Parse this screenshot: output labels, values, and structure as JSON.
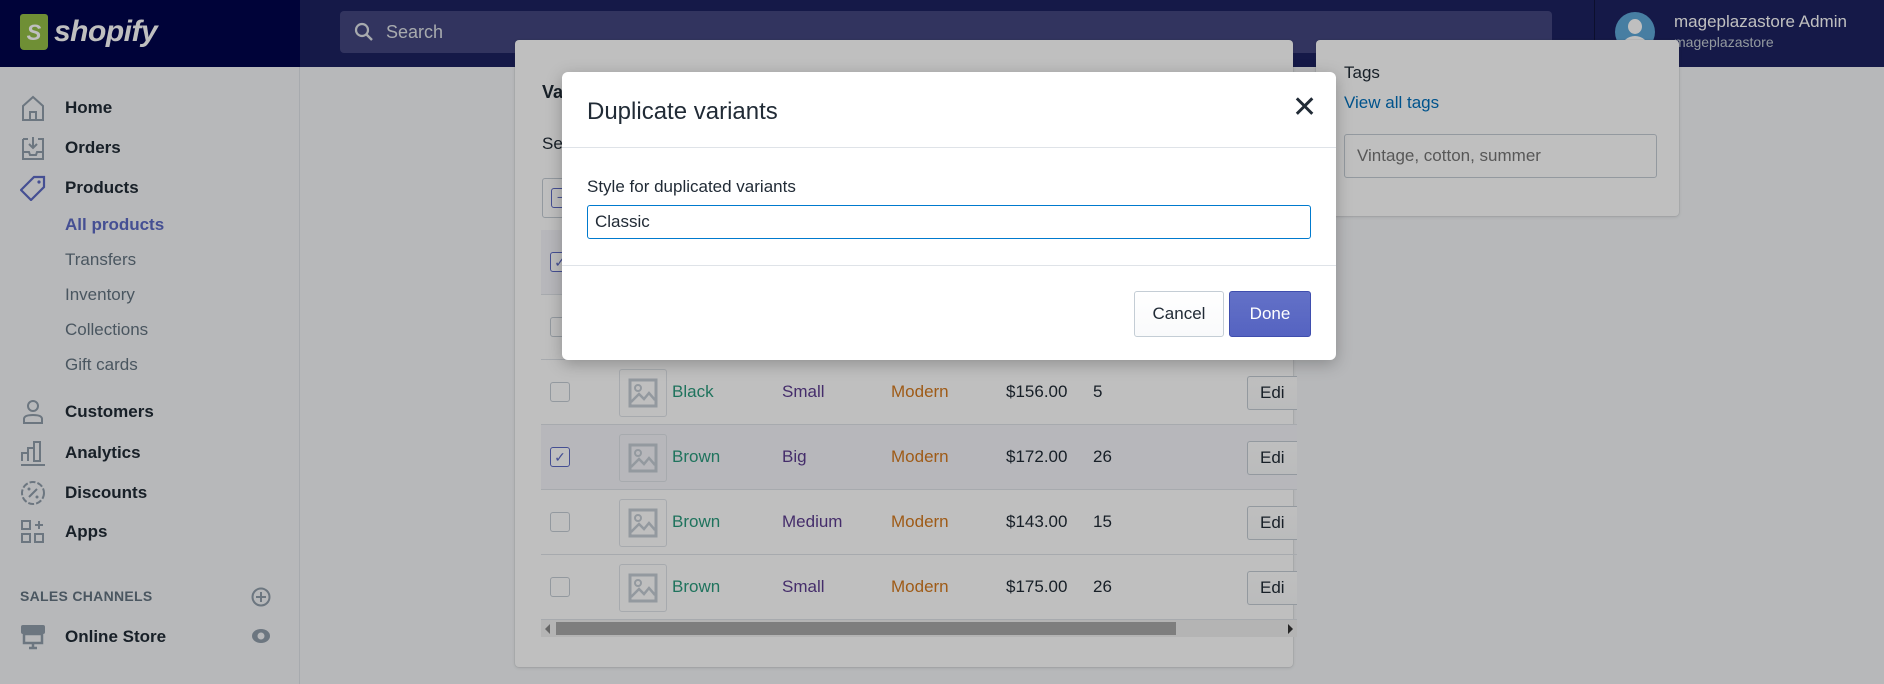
{
  "topbar": {
    "brand": "shopify",
    "brand_icon": "shopify-bag-icon",
    "search_placeholder": "Search",
    "user_name": "mageplazastore Admin",
    "store_name": "mageplazastore"
  },
  "sidebar": {
    "items": [
      {
        "label": "Home",
        "icon": "home-icon"
      },
      {
        "label": "Orders",
        "icon": "orders-icon"
      },
      {
        "label": "Products",
        "icon": "tag-icon"
      }
    ],
    "product_subitems": [
      "All products",
      "Transfers",
      "Inventory",
      "Collections",
      "Gift cards"
    ],
    "items2": [
      {
        "label": "Customers",
        "icon": "person-icon"
      },
      {
        "label": "Analytics",
        "icon": "bar-chart-icon"
      },
      {
        "label": "Discounts",
        "icon": "discount-icon"
      },
      {
        "label": "Apps",
        "icon": "apps-icon"
      }
    ],
    "sales_channels_label": "SALES CHANNELS",
    "online_store": "Online Store"
  },
  "variants_card": {
    "title_partial": "Va",
    "select_partial": "Sel",
    "rows": [
      {
        "color": "Black",
        "size": "Small",
        "style": "Modern",
        "price": "$156.00",
        "qty": "5",
        "checked": false,
        "edit": "Edi"
      },
      {
        "color": "Brown",
        "size": "Big",
        "style": "Modern",
        "price": "$172.00",
        "qty": "26",
        "checked": true,
        "edit": "Edi"
      },
      {
        "color": "Brown",
        "size": "Medium",
        "style": "Modern",
        "price": "$143.00",
        "qty": "15",
        "checked": false,
        "edit": "Edi"
      },
      {
        "color": "Brown",
        "size": "Small",
        "style": "Modern",
        "price": "$175.00",
        "qty": "26",
        "checked": false,
        "edit": "Edi"
      }
    ]
  },
  "tags_card": {
    "title": "Tags",
    "view_all": "View all tags",
    "placeholder": "Vintage, cotton, summer"
  },
  "modal": {
    "title": "Duplicate variants",
    "field_label": "Style for duplicated variants",
    "field_value": "Classic",
    "cancel": "Cancel",
    "done": "Done"
  },
  "colors": {
    "accent": "#5c6ac4",
    "option1": "#2a9a7c",
    "option2": "#5c3d8f",
    "option3": "#d47a1f",
    "link": "#006fbb"
  }
}
